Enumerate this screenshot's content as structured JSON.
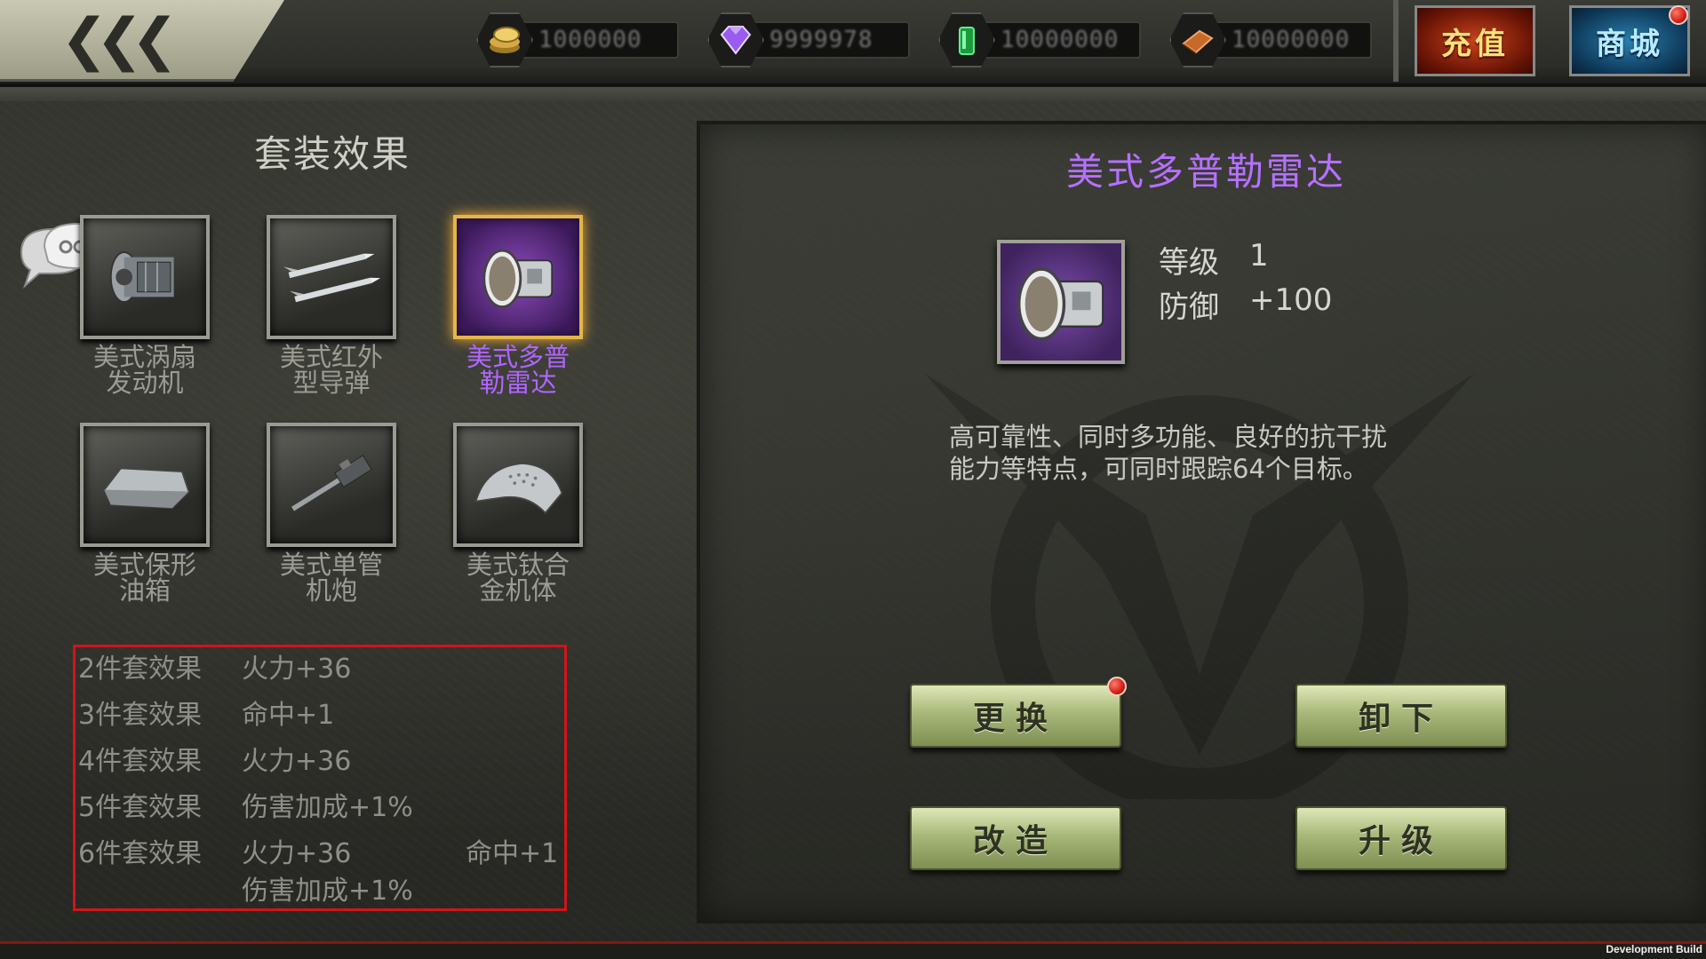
{
  "topbar": {
    "back_icon": "triple-chevron-left-icon",
    "resources": [
      {
        "icon": "gold-coin-icon",
        "value": "1000000"
      },
      {
        "icon": "purple-diamond-icon",
        "value": "9999978"
      },
      {
        "icon": "green-fuel-icon",
        "value": "10000000"
      },
      {
        "icon": "bronze-ingot-icon",
        "value": "10000000"
      }
    ],
    "recharge_label": "充值",
    "shop_label": "商城"
  },
  "set": {
    "title": "套装效果",
    "items": [
      {
        "name": "美式涡扇发动机",
        "line1": "美式涡扇",
        "line2": "发动机",
        "icon": "turbofan-engine-icon",
        "selected": false
      },
      {
        "name": "美式红外型导弹",
        "line1": "美式红外",
        "line2": "型导弹",
        "icon": "missile-icon",
        "selected": false
      },
      {
        "name": "美式多普勒雷达",
        "line1": "美式多普",
        "line2": "勒雷达",
        "icon": "radar-icon",
        "selected": true
      },
      {
        "name": "美式保形油箱",
        "line1": "美式保形",
        "line2": "油箱",
        "icon": "fuel-tank-icon",
        "selected": false
      },
      {
        "name": "美式单管机炮",
        "line1": "美式单管",
        "line2": "机炮",
        "icon": "cannon-icon",
        "selected": false
      },
      {
        "name": "美式钛合金机体",
        "line1": "美式钛合",
        "line2": "金机体",
        "icon": "airframe-icon",
        "selected": false
      }
    ],
    "effects": [
      {
        "label": "2件套效果",
        "values": [
          "火力+36"
        ]
      },
      {
        "label": "3件套效果",
        "values": [
          "命中+1"
        ]
      },
      {
        "label": "4件套效果",
        "values": [
          "火力+36"
        ]
      },
      {
        "label": "5件套效果",
        "values": [
          "伤害加成+1%"
        ]
      },
      {
        "label": "6件套效果",
        "values": [
          "火力+36",
          "命中+1",
          "伤害加成+1%"
        ]
      }
    ]
  },
  "detail": {
    "title": "美式多普勒雷达",
    "level_label": "等级",
    "level_value": "1",
    "defense_label": "防御",
    "defense_value": "+100",
    "description": "高可靠性、同时多功能、良好的抗干扰能力等特点，可同时跟踪64个目标。",
    "desc_line1": "高可靠性、同时多功能、良好的抗干扰",
    "desc_line2": "能力等特点，可同时跟踪64个目标。",
    "buttons": {
      "replace": "更换",
      "unequip": "卸下",
      "modify": "改造",
      "upgrade": "升级"
    }
  },
  "footer": {
    "dev_build": "Development Build"
  },
  "colors": {
    "accent_purple": "#b670ff",
    "highlight_red": "#d2141b",
    "button_green": "#a8b87a"
  }
}
